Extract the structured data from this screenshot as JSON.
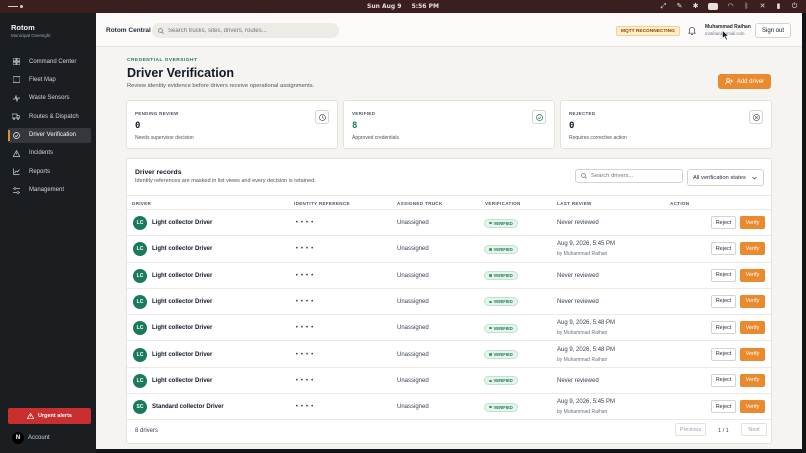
{
  "menubar": {
    "date": "Sun Aug 9",
    "time": "5:56 PM"
  },
  "sidebar": {
    "brand": "Rotom",
    "brand_sub": "Municipal Oversight",
    "items": [
      {
        "label": "Command Center",
        "icon": "grid-icon"
      },
      {
        "label": "Fleet Map",
        "icon": "map-icon"
      },
      {
        "label": "Waste Sensors",
        "icon": "sensor-icon"
      },
      {
        "label": "Routes & Dispatch",
        "icon": "truck-icon"
      },
      {
        "label": "Driver Verification",
        "icon": "badge-check-icon",
        "active": true
      },
      {
        "label": "Incidents",
        "icon": "warning-icon"
      },
      {
        "label": "Reports",
        "icon": "chart-icon"
      },
      {
        "label": "Management",
        "icon": "sliders-icon"
      }
    ],
    "urgent_label": "Urgent alerts",
    "account_label": "Account",
    "account_avatar": "N"
  },
  "topbar": {
    "title": "Rotom Central",
    "search_placeholder": "Search trucks, sites, drivers, routes...",
    "mqtt_status": "MQTT RECONNECTING",
    "user_name": "Muhammad Raihan",
    "user_email": "mraihan@gmail.com",
    "signout_label": "Sign out"
  },
  "page": {
    "eyebrow": "CREDENTIAL OVERSIGHT",
    "title": "Driver Verification",
    "subtitle": "Review identity evidence before drivers receive operational assignments.",
    "add_driver_label": "Add driver"
  },
  "stats": [
    {
      "label": "PENDING REVIEW",
      "value": "0",
      "note": "Needs supervisor decision",
      "icon": "clock-icon"
    },
    {
      "label": "VERIFIED",
      "value": "8",
      "note": "Approved credentials",
      "icon": "check-circle-icon"
    },
    {
      "label": "REJECTED",
      "value": "0",
      "note": "Requires corrective action",
      "icon": "x-circle-icon"
    }
  ],
  "records": {
    "title": "Driver records",
    "subtitle": "Identity references are masked in list views and every decision is retained.",
    "search_placeholder": "Search drivers...",
    "filter_value": "All verification states",
    "columns": [
      "DRIVER",
      "IDENTITY REFERENCE",
      "ASSIGNED TRUCK",
      "VERIFICATION",
      "LAST REVIEW",
      "ACTION"
    ],
    "reject_label": "Reject",
    "verify_label": "Verify",
    "rows": [
      {
        "initials": "LC",
        "name": "Light collector Driver",
        "id_ref": "••••",
        "truck": "Unassigned",
        "status": "VERIFIED",
        "review": "Never reviewed",
        "reviewer": ""
      },
      {
        "initials": "LC",
        "name": "Light collector Driver",
        "id_ref": "••••",
        "truck": "Unassigned",
        "status": "VERIFIED",
        "review": "Aug 9, 2026, 5:45 PM",
        "reviewer": "by Muhammad Raihan"
      },
      {
        "initials": "LC",
        "name": "Light collector Driver",
        "id_ref": "••••",
        "truck": "Unassigned",
        "status": "VERIFIED",
        "review": "Never reviewed",
        "reviewer": ""
      },
      {
        "initials": "LC",
        "name": "Light collector Driver",
        "id_ref": "••••",
        "truck": "Unassigned",
        "status": "VERIFIED",
        "review": "Never reviewed",
        "reviewer": ""
      },
      {
        "initials": "LC",
        "name": "Light collector Driver",
        "id_ref": "••••",
        "truck": "Unassigned",
        "status": "VERIFIED",
        "review": "Aug 9, 2026, 5:48 PM",
        "reviewer": "by Muhammad Raihan"
      },
      {
        "initials": "LC",
        "name": "Light collector Driver",
        "id_ref": "••••",
        "truck": "Unassigned",
        "status": "VERIFIED",
        "review": "Aug 9, 2026, 5:48 PM",
        "reviewer": "by Muhammad Raihan"
      },
      {
        "initials": "LC",
        "name": "Light collector Driver",
        "id_ref": "••••",
        "truck": "Unassigned",
        "status": "VERIFIED",
        "review": "Never reviewed",
        "reviewer": ""
      },
      {
        "initials": "SC",
        "name": "Standard collector Driver",
        "id_ref": "••••",
        "truck": "Unassigned",
        "status": "VERIFIED",
        "review": "Aug 9, 2026, 5:45 PM",
        "reviewer": "by Muhammad Raihan"
      }
    ],
    "count_label": "8 drivers",
    "prev_label": "Previous",
    "page_indicator": "1 / 1",
    "next_label": "Next"
  },
  "colors": {
    "accent": "#e98a2f",
    "brand_green": "#1b7a5a",
    "urgent_red": "#c92f2f"
  }
}
